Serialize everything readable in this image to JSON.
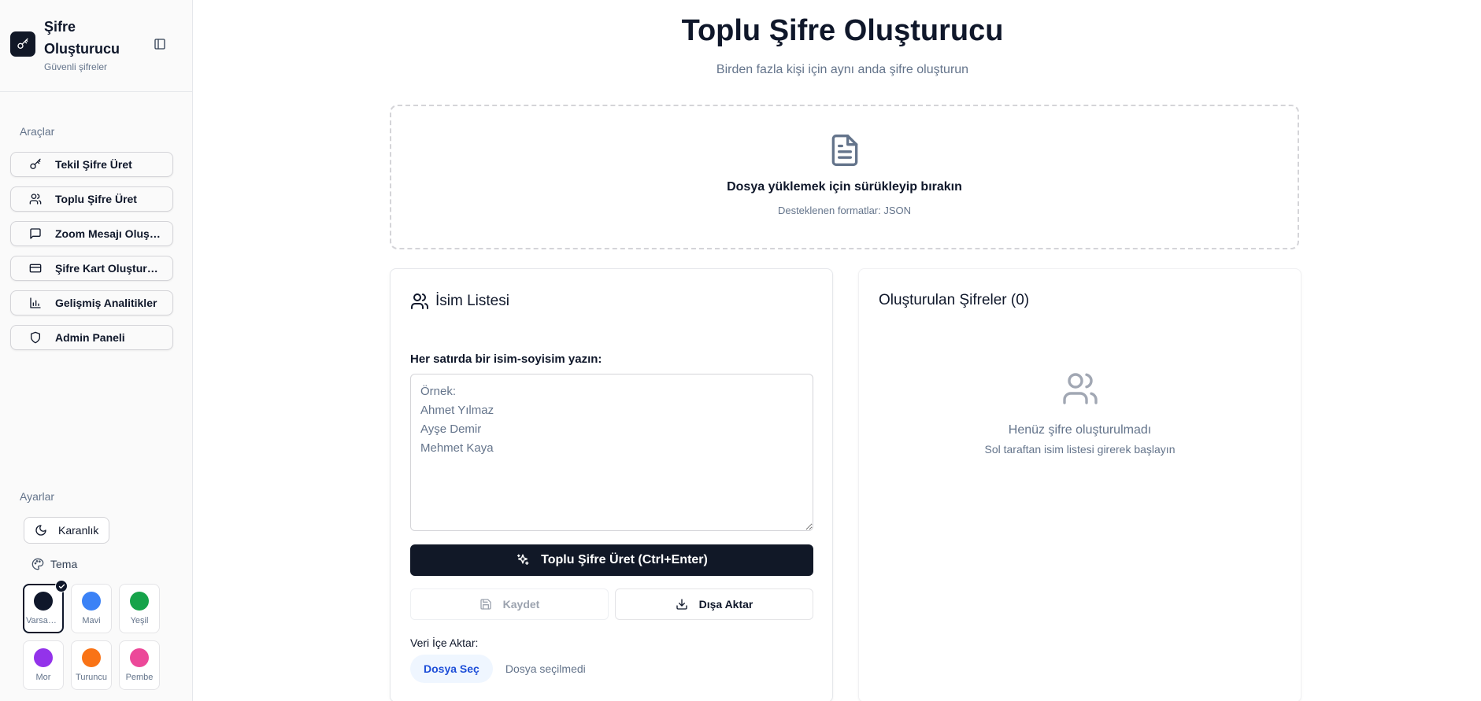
{
  "sidebar": {
    "title": "Şifre Oluşturucu",
    "subtitle": "Güvenli şifreler",
    "tools_label": "Araçlar",
    "items": [
      {
        "label": "Tekil Şifre Üret",
        "icon": "key-icon"
      },
      {
        "label": "Toplu Şifre Üret",
        "icon": "users-icon"
      },
      {
        "label": "Zoom Mesajı Oluştur",
        "icon": "message-square-icon"
      },
      {
        "label": "Şifre Kart Oluşturucu",
        "icon": "credit-card-icon"
      },
      {
        "label": "Gelişmiş Analitikler",
        "icon": "bar-chart-icon"
      },
      {
        "label": "Admin Paneli",
        "icon": "shield-icon"
      }
    ],
    "settings_label": "Ayarlar",
    "dark_mode_label": "Karanlık",
    "theme_label": "Tema",
    "themes": [
      {
        "name": "Varsayılan",
        "color": "#0f172a",
        "selected": true
      },
      {
        "name": "Mavi",
        "color": "#3b82f6",
        "selected": false
      },
      {
        "name": "Yeşil",
        "color": "#16a34a",
        "selected": false
      },
      {
        "name": "Mor",
        "color": "#9333ea",
        "selected": false
      },
      {
        "name": "Turuncu",
        "color": "#f97316",
        "selected": false
      },
      {
        "name": "Pembe",
        "color": "#ec4899",
        "selected": false
      }
    ]
  },
  "main": {
    "title": "Toplu Şifre Oluşturucu",
    "subtitle": "Birden fazla kişi için aynı anda şifre oluşturun",
    "dropzone": {
      "title": "Dosya yüklemek için sürükleyip bırakın",
      "subtitle": "Desteklenen formatlar: JSON"
    },
    "names_card": {
      "title": "İsim Listesi",
      "field_label": "Her satırda bir isim-soyisim yazın:",
      "placeholder": "Örnek:\nAhmet Yılmaz\nAyşe Demir\nMehmet Kaya",
      "value": "",
      "generate_label": "Toplu Şifre Üret (Ctrl+Enter)",
      "save_label": "Kaydet",
      "export_label": "Dışa Aktar",
      "import_label": "Veri İçe Aktar:",
      "file_button_label": "Dosya Seç",
      "file_status": "Dosya seçilmedi"
    },
    "results_card": {
      "title": "Oluşturulan Şifreler (0)",
      "empty_title": "Henüz şifre oluşturulmadı",
      "empty_subtitle": "Sol taraftan isim listesi girerek başlayın"
    }
  },
  "colors": {
    "primary": "#111827",
    "muted_text": "#64748b",
    "border": "#e5e7eb",
    "file_button_bg": "#eff6ff",
    "file_button_text": "#1d4ed8"
  }
}
